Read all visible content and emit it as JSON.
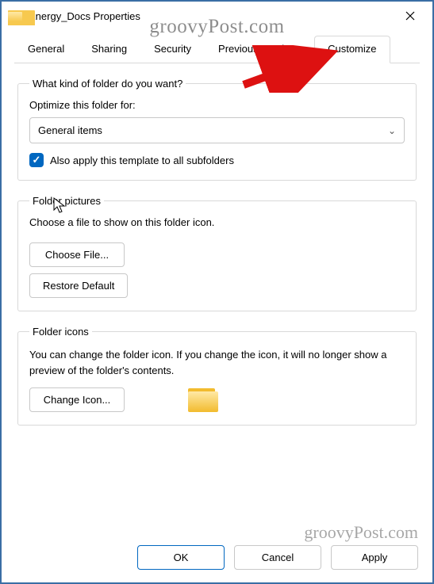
{
  "window": {
    "title": "Energy_Docs Properties"
  },
  "watermark": "groovyPost.com",
  "tabs": {
    "general": "General",
    "sharing": "Sharing",
    "security": "Security",
    "previous": "Previous Versions",
    "customize": "Customize",
    "active": "customize"
  },
  "optimize": {
    "legend": "What kind of folder do you want?",
    "label": "Optimize this folder for:",
    "combo_value": "General items",
    "checkbox_label": "Also apply this template to all subfolders",
    "checkbox_checked": true
  },
  "pictures": {
    "legend": "Folder pictures",
    "desc": "Choose a file to show on this folder icon.",
    "choose_btn": "Choose File...",
    "restore_btn": "Restore Default"
  },
  "icons": {
    "legend": "Folder icons",
    "desc": "You can change the folder icon. If you change the icon, it will no longer show a preview of the folder's contents.",
    "change_btn": "Change Icon..."
  },
  "buttons": {
    "ok": "OK",
    "cancel": "Cancel",
    "apply": "Apply"
  }
}
